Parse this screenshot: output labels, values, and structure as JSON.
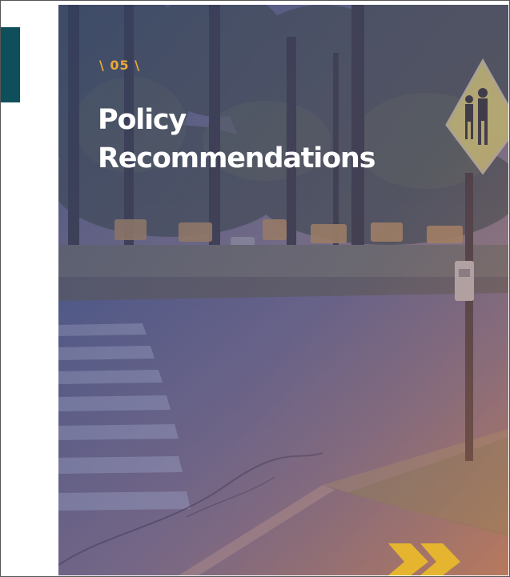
{
  "section": {
    "number": "\\ 05 \\"
  },
  "title": {
    "line1": "Policy",
    "line2": "Recommendations"
  },
  "colors": {
    "accent_bar": "#0f4f5c",
    "section_number": "#e9a93a",
    "title_text": "#ffffff",
    "overlay_top": "#3f4f7e",
    "overlay_bottom": "#b8755a",
    "chevron": "#e6b52f"
  },
  "image": {
    "subject": "school crossing with crosswalk, school zone sign and school buses"
  }
}
